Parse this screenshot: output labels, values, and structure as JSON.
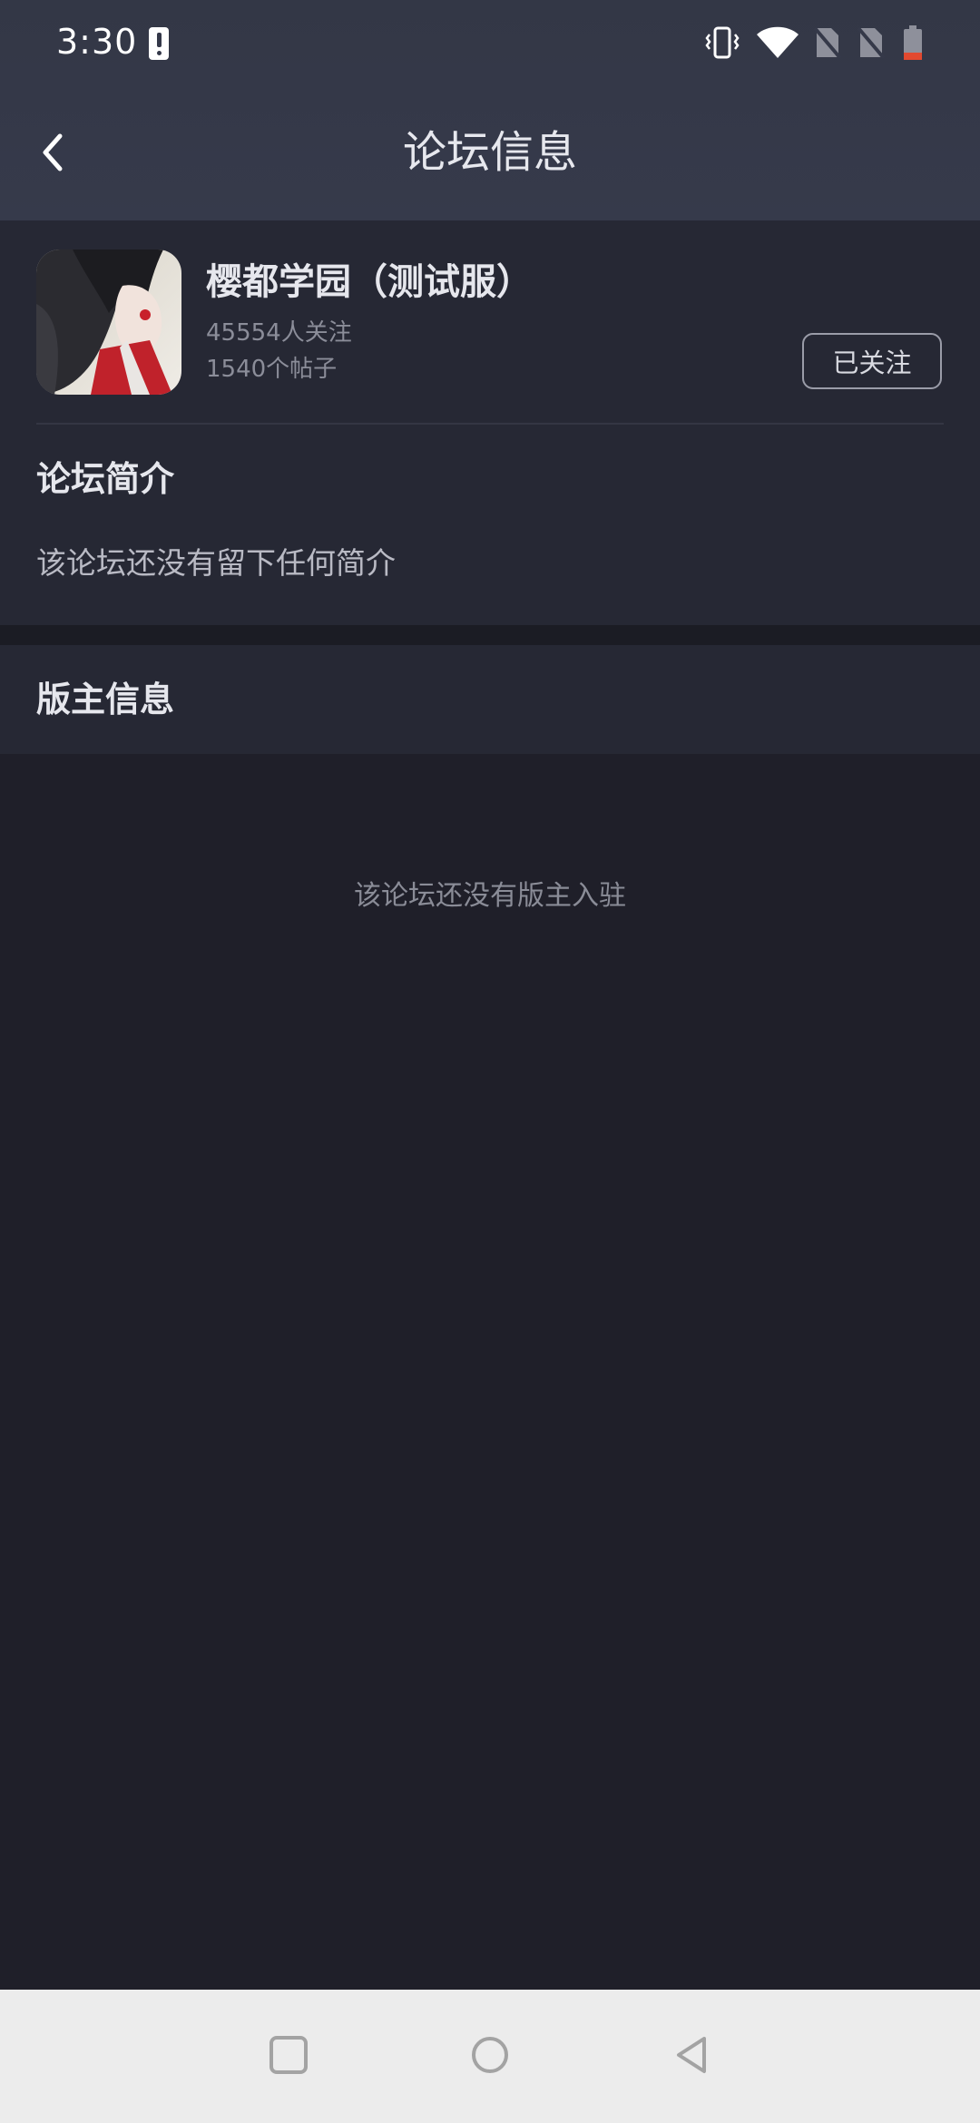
{
  "status_bar": {
    "time": "3:30",
    "icons": [
      "alert-icon",
      "vibrate-icon",
      "wifi-icon",
      "no-sim-icon",
      "no-sim-icon",
      "battery-low-icon"
    ]
  },
  "app_bar": {
    "title": "论坛信息",
    "back_icon": "chevron-left-icon"
  },
  "forum": {
    "name": "樱都学园（测试服）",
    "followers": "45554人关注",
    "posts": "1540个帖子",
    "follow_label": "已关注"
  },
  "intro": {
    "heading": "论坛简介",
    "text": "该论坛还没有留下任何简介"
  },
  "moderators": {
    "heading": "版主信息",
    "empty_text": "该论坛还没有版主入驻"
  },
  "nav_bar": {
    "buttons": [
      "recents-square-icon",
      "home-circle-icon",
      "back-triangle-icon"
    ]
  },
  "colors": {
    "background": "#1f1f29",
    "header": "#353949",
    "card": "#262834",
    "battery_low": "#e2492f"
  }
}
